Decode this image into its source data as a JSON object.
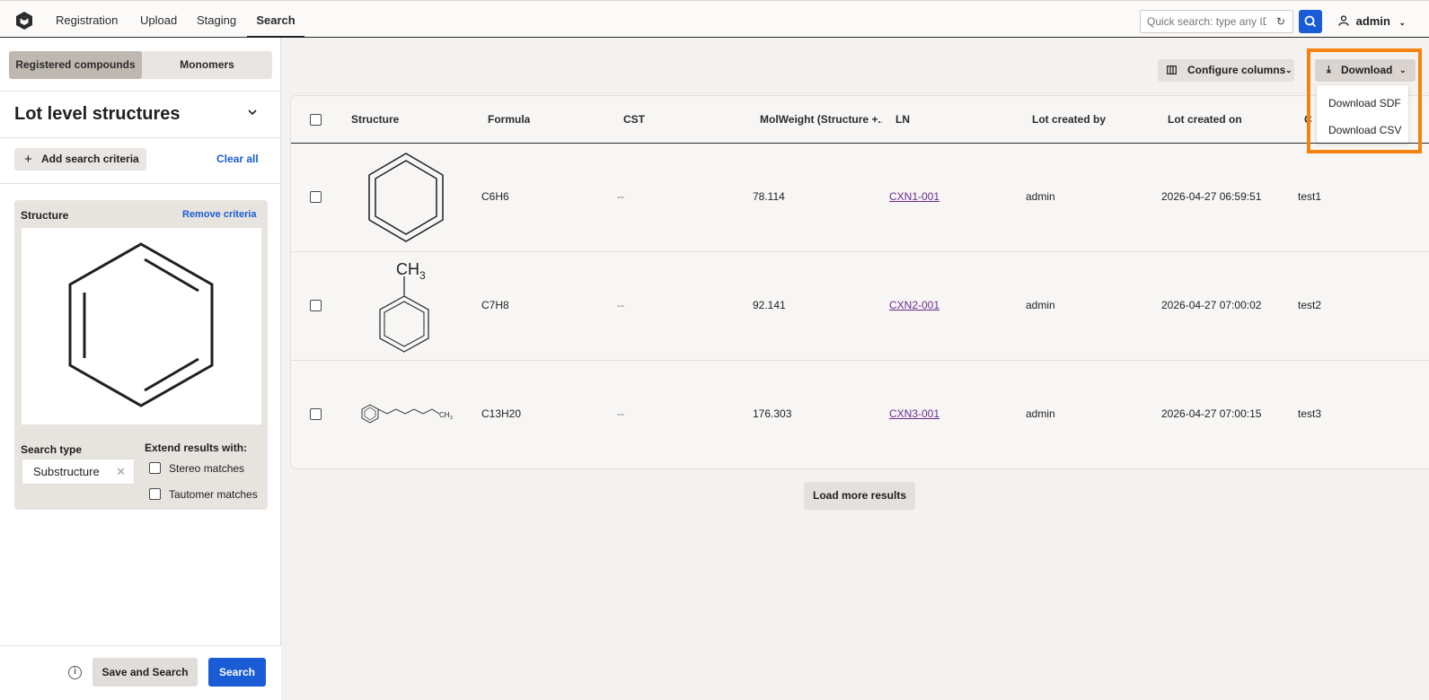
{
  "nav": {
    "tabs": [
      {
        "label": "Registration"
      },
      {
        "label": "Upload"
      },
      {
        "label": "Staging"
      },
      {
        "label": "Search",
        "active": true
      }
    ],
    "quick_search_placeholder": "Quick search: type any ID...",
    "user": "admin"
  },
  "left_panel": {
    "segments": [
      {
        "label": "Registered compounds",
        "active": true
      },
      {
        "label": "Monomers"
      }
    ],
    "title": "Lot level structures",
    "add_criteria_label": "Add search criteria",
    "clear_all_label": "Clear all",
    "criteria": {
      "title": "Structure",
      "remove_label": "Remove criteria",
      "search_type_label": "Search type",
      "search_type_value": "Substructure",
      "extend_label": "Extend results with:",
      "options": [
        {
          "label": "Stereo matches",
          "checked": false
        },
        {
          "label": "Tautomer matches",
          "checked": false
        }
      ]
    },
    "footer": {
      "save_search_label": "Save and Search",
      "search_label": "Search"
    }
  },
  "toolbar": {
    "configure_label": "Configure columns",
    "download_label": "Download",
    "download_menu": [
      "Download SDF",
      "Download CSV"
    ]
  },
  "table": {
    "headers": [
      "Structure",
      "Formula",
      "CST",
      "MolWeight (Structure +...",
      "LN",
      "Lot created by",
      "Lot created on",
      "C"
    ],
    "rows": [
      {
        "structure": "benzene-icon",
        "formula": "C6H6",
        "cst": "--",
        "molweight": "78.114",
        "ln": "CXN1-001",
        "created_by": "admin",
        "created_on": "2026-04-27 06:59:51",
        "extra": "test1"
      },
      {
        "structure": "toluene-icon",
        "formula": "C7H8",
        "cst": "--",
        "molweight": "92.141",
        "ln": "CXN2-001",
        "created_by": "admin",
        "created_on": "2026-04-27 07:00:02",
        "extra": "test2"
      },
      {
        "structure": "heptylbenzene-icon",
        "formula": "C13H20",
        "cst": "--",
        "molweight": "176.303",
        "ln": "CXN3-001",
        "created_by": "admin",
        "created_on": "2026-04-27 07:00:15",
        "extra": "test3"
      }
    ],
    "toluene_label": "CH",
    "toluene_sub": "3",
    "chain_label": "CH",
    "chain_sub": "3",
    "load_more_label": "Load more results"
  },
  "colors": {
    "accent": "#1a5bd6",
    "highlight": "#f5820d",
    "link": "#6b2a8c"
  }
}
